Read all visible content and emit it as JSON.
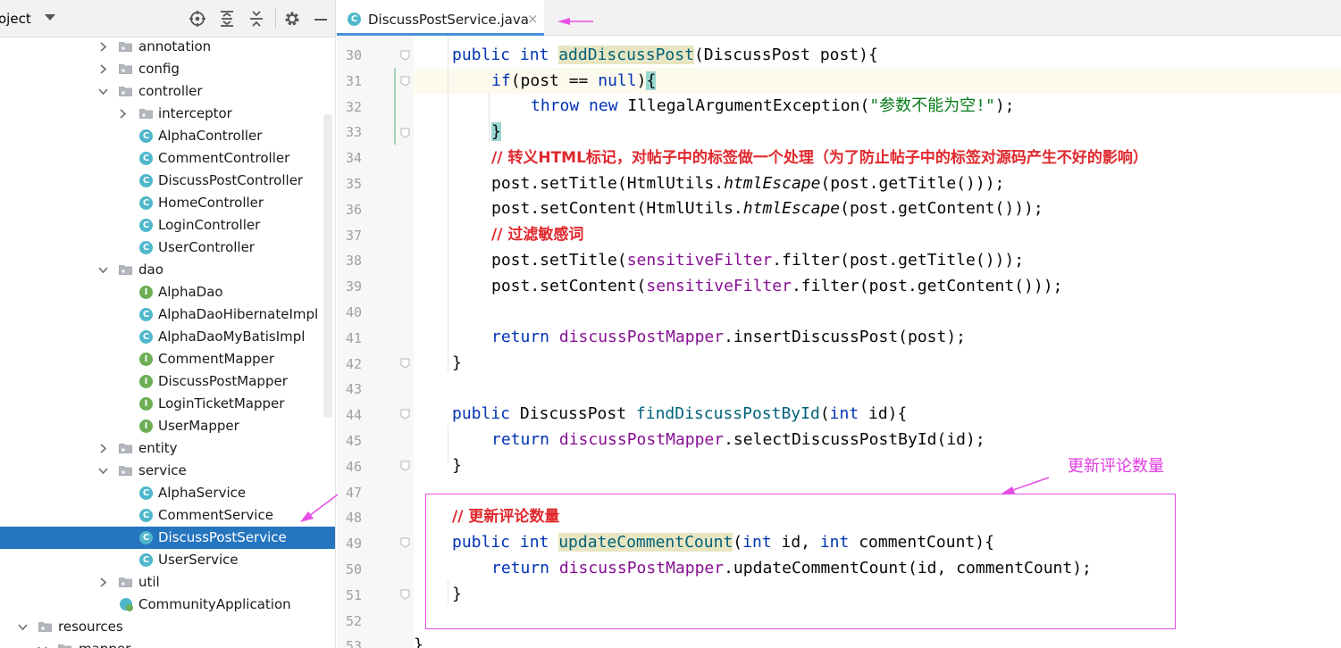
{
  "project_panel": {
    "title": "oject",
    "tree": [
      {
        "label": "annotation",
        "type": "package",
        "expanded": false
      },
      {
        "label": "config",
        "type": "package",
        "expanded": false
      },
      {
        "label": "controller",
        "type": "package",
        "expanded": true
      },
      {
        "label": "interceptor",
        "type": "package",
        "expanded": false
      },
      {
        "label": "AlphaController",
        "type": "class"
      },
      {
        "label": "CommentController",
        "type": "class"
      },
      {
        "label": "DiscussPostController",
        "type": "class"
      },
      {
        "label": "HomeController",
        "type": "class"
      },
      {
        "label": "LoginController",
        "type": "class"
      },
      {
        "label": "UserController",
        "type": "class"
      },
      {
        "label": "dao",
        "type": "package",
        "expanded": true
      },
      {
        "label": "AlphaDao",
        "type": "interface"
      },
      {
        "label": "AlphaDaoHibernateImpl",
        "type": "class"
      },
      {
        "label": "AlphaDaoMyBatisImpl",
        "type": "class"
      },
      {
        "label": "CommentMapper",
        "type": "interface"
      },
      {
        "label": "DiscussPostMapper",
        "type": "interface"
      },
      {
        "label": "LoginTicketMapper",
        "type": "interface"
      },
      {
        "label": "UserMapper",
        "type": "interface"
      },
      {
        "label": "entity",
        "type": "package",
        "expanded": false
      },
      {
        "label": "service",
        "type": "package",
        "expanded": true
      },
      {
        "label": "AlphaService",
        "type": "class"
      },
      {
        "label": "CommentService",
        "type": "class"
      },
      {
        "label": "DiscussPostService",
        "type": "class",
        "selected": true
      },
      {
        "label": "UserService",
        "type": "class"
      },
      {
        "label": "util",
        "type": "package",
        "expanded": false
      },
      {
        "label": "CommunityApplication",
        "type": "spring-app"
      },
      {
        "label": "resources",
        "type": "resources",
        "expanded": true
      },
      {
        "label": "mapper",
        "type": "package",
        "expanded": true
      }
    ]
  },
  "editor": {
    "tab": {
      "title": "DiscussPostService.java",
      "close": "×"
    },
    "line_numbers": [
      "30",
      "31",
      "32",
      "33",
      "34",
      "35",
      "36",
      "37",
      "38",
      "39",
      "40",
      "41",
      "42",
      "43",
      "44",
      "45",
      "46",
      "47",
      "48",
      "49",
      "50",
      "51",
      "52",
      "53"
    ],
    "code": {
      "l30": {
        "kw": "public int ",
        "name": "addDiscussPost",
        "rest": "(DiscussPost post){"
      },
      "l31": {
        "kw1": "if",
        "mid": "(post == ",
        "kw2": "null",
        "close": ")",
        "brace": "{"
      },
      "l32": {
        "kw": "throw new ",
        "cls": "IllegalArgumentException(",
        "str": "\"参数不能为空!\"",
        "end": ");"
      },
      "l33": {
        "brace": "}"
      },
      "l34": {
        "comment": "// 转义HTML标记，对帖子中的标签做一个处理（为了防止帖子中的标签对源码产生不好的影响）"
      },
      "l35": {
        "a": "post.setTitle(HtmlUtils.",
        "i": "htmlEscape",
        "b": "(post.getTitle()));"
      },
      "l36": {
        "a": "post.setContent(HtmlUtils.",
        "i": "htmlEscape",
        "b": "(post.getContent()));"
      },
      "l37": {
        "comment": "// 过滤敏感词"
      },
      "l38": {
        "a": "post.setTitle(",
        "f": "sensitiveFilter",
        "b": ".filter(post.getTitle()));"
      },
      "l39": {
        "a": "post.setContent(",
        "f": "sensitiveFilter",
        "b": ".filter(post.getContent()));"
      },
      "l41": {
        "kw": "return ",
        "f": "discussPostMapper",
        "b": ".insertDiscussPost(post);"
      },
      "l42": {
        "brace": "}"
      },
      "l44": {
        "kw": "public ",
        "type": "DiscussPost ",
        "name": "findDiscussPostById",
        "p1": "(",
        "kw2": "int",
        "p2": " id){"
      },
      "l45": {
        "kw": "return ",
        "f": "discussPostMapper",
        "b": ".selectDiscussPostById(id);"
      },
      "l46": {
        "brace": "}"
      },
      "l48": {
        "comment": "// 更新评论数量"
      },
      "l49": {
        "kw": "public int ",
        "name": "updateCommentCount",
        "p1": "(",
        "kw2": "int",
        "p2": " id, ",
        "kw3": "int",
        "p3": " commentCount){"
      },
      "l50": {
        "kw": "return ",
        "f": "discussPostMapper",
        "b": ".updateCommentCount(id, commentCount);"
      },
      "l51": {
        "brace": "}"
      },
      "l53": {
        "brace": "}"
      }
    }
  },
  "annotation": {
    "text": "更新评论数量",
    "color": "#e13be1"
  },
  "colors": {
    "selection": "#2675bf",
    "keyword": "#0033b3",
    "field": "#871094",
    "method_decl": "#00627a",
    "string": "#067d17",
    "comment": "#e0282d",
    "annotation": "#e64ee6"
  }
}
